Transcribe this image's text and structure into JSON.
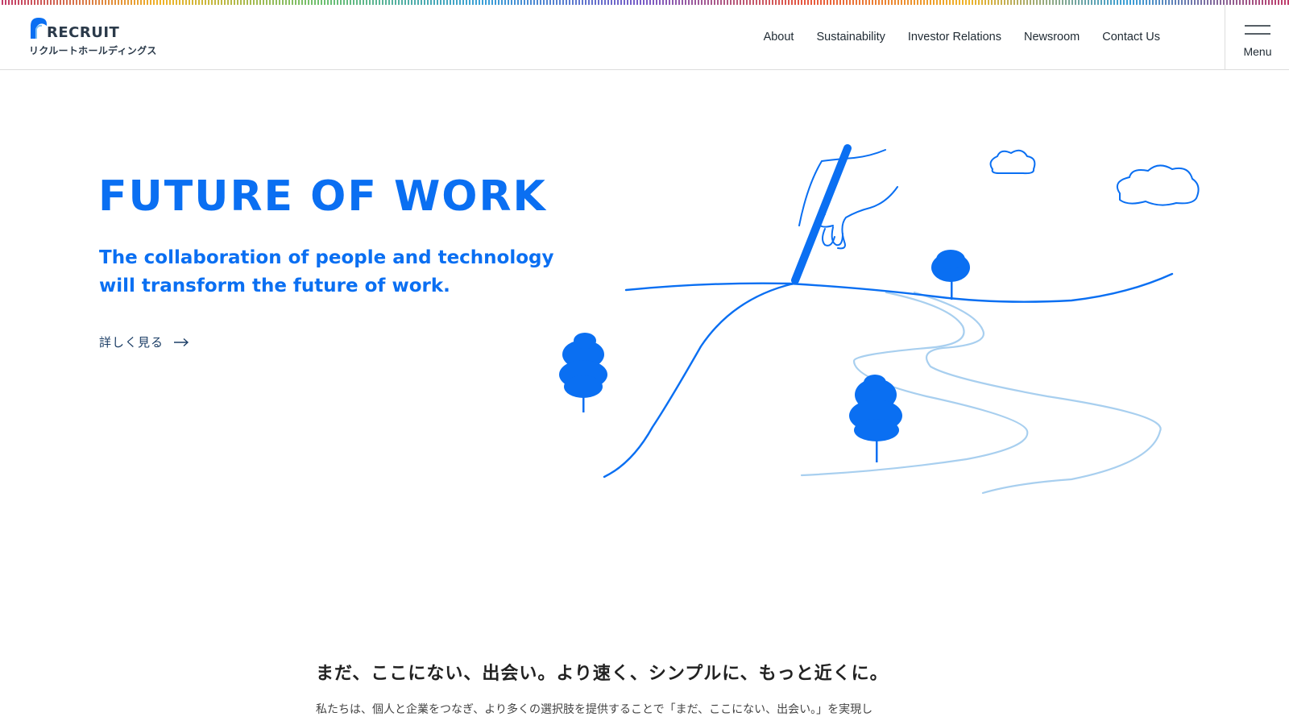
{
  "header": {
    "logo_word": "RECRUIT",
    "logo_sub": "リクルートホールディングス",
    "nav": [
      "About",
      "Sustainability",
      "Investor Relations",
      "Newsroom",
      "Contact Us"
    ],
    "menu_label": "Menu"
  },
  "hero": {
    "title": "FUTURE OF WORK",
    "subtitle_line1": "The collaboration of people and technology",
    "subtitle_line2": "will transform the future of work.",
    "more_label": "詳しく見る"
  },
  "mission": {
    "title": "まだ、ここにない、出会い。より速く、シンプルに、もっと近くに。",
    "body": "私たちは、個人と企業をつなぎ、より多くの選択肢を提供することで「まだ、ここにない、出会い。」を実現し"
  },
  "colors": {
    "accent": "#0a6ff2",
    "river": "#a8cfef",
    "text": "#1f2a33"
  },
  "icons": [
    "recruit-logo-mark",
    "hamburger-menu-icon",
    "arrow-right-icon",
    "hand-drawing-illustration"
  ]
}
